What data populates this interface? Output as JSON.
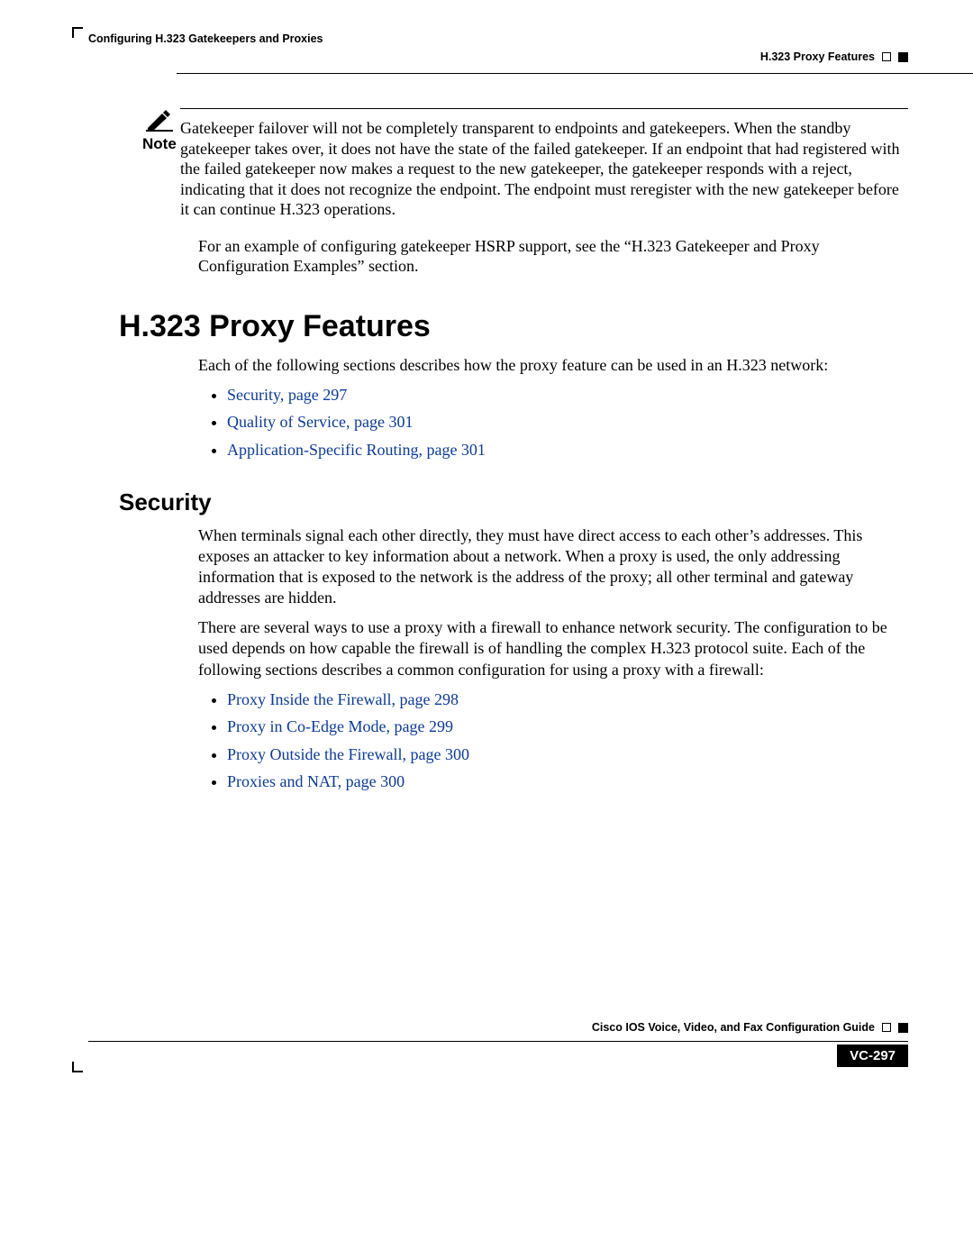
{
  "header": {
    "left": "Configuring H.323 Gatekeepers and Proxies",
    "right": "H.323 Proxy Features"
  },
  "note": {
    "label": "Note",
    "body": "Gatekeeper failover will not be completely transparent to endpoints and gatekeepers. When the standby gatekeeper takes over, it does not have the state of the failed gatekeeper. If an endpoint that had registered with the failed gatekeeper now makes a request to the new gatekeeper, the gatekeeper responds with a reject, indicating that it does not recognize the endpoint. The endpoint must reregister with the new gatekeeper before it can continue H.323 operations."
  },
  "after_note": "For an example of configuring gatekeeper HSRP support, see the “H.323 Gatekeeper and Proxy Configuration Examples” section.",
  "h1": "H.323 Proxy Features",
  "h1_intro": "Each of the following sections describes how the proxy feature can be used in an H.323 network:",
  "links1": [
    "Security, page 297",
    "Quality of Service, page 301",
    "Application-Specific Routing, page 301"
  ],
  "h2": "Security",
  "sec_p1": "When terminals signal each other directly, they must have direct access to each other’s addresses. This exposes an attacker to key information about a network. When a proxy is used, the only addressing information that is exposed to the network is the address of the proxy; all other terminal and gateway addresses are hidden.",
  "sec_p2": "There are several ways to use a proxy with a firewall to enhance network security. The configuration to be used depends on how capable the firewall is of handling the complex H.323 protocol suite. Each of the following sections describes a common configuration for using a proxy with a firewall:",
  "links2": [
    "Proxy Inside the Firewall, page 298",
    "Proxy in Co-Edge Mode, page 299",
    "Proxy Outside the Firewall, page 300",
    "Proxies and NAT, page 300"
  ],
  "footer": {
    "title": "Cisco IOS Voice, Video, and Fax Configuration Guide",
    "page": "VC-297"
  }
}
